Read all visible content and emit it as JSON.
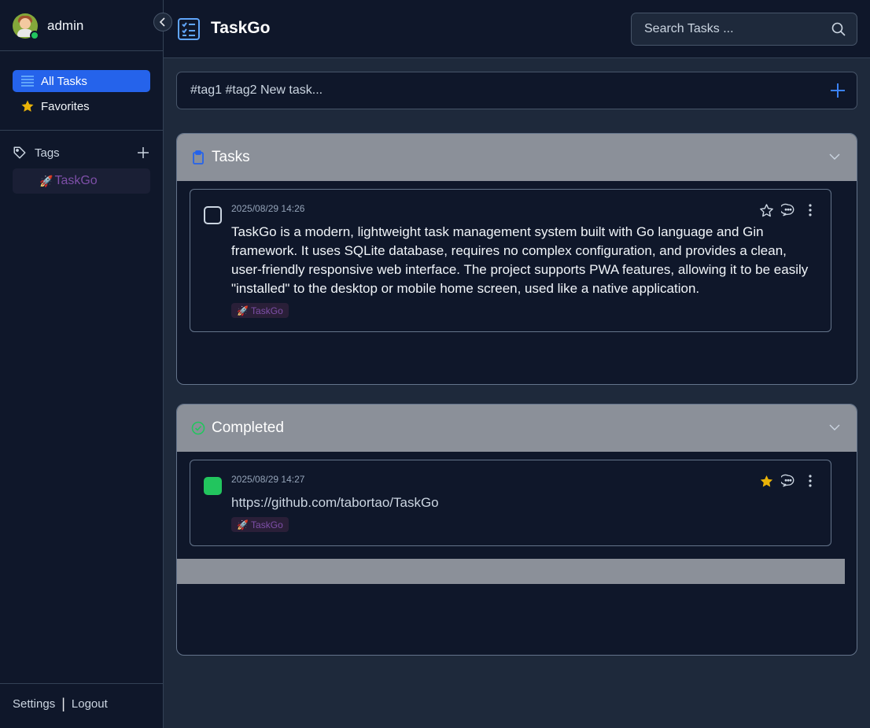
{
  "user": {
    "name": "admin"
  },
  "sidebar": {
    "nav": [
      {
        "label": "All Tasks",
        "icon": "list-icon"
      },
      {
        "label": "Favorites",
        "icon": "star-icon"
      }
    ],
    "tags_header": "Tags",
    "tags": [
      {
        "emoji": "🚀",
        "label": "TaskGo"
      }
    ],
    "footer": {
      "settings": "Settings",
      "separator": "|",
      "logout": "Logout"
    }
  },
  "header": {
    "title": "TaskGo",
    "search_placeholder": "Search Tasks ..."
  },
  "new_task": {
    "placeholder": "#tag1 #tag2 New task..."
  },
  "sections": [
    {
      "title": "Tasks",
      "tasks": [
        {
          "date": "2025/08/29 14:26",
          "text": "TaskGo is a modern, lightweight task management system built with Go language and Gin framework. It uses SQLite database, requires no complex configuration, and provides a clean, user-friendly responsive web interface. The project supports PWA features, allowing it to be easily \"installed\" to the desktop or mobile home screen, used like a native application.",
          "tag": "🚀 TaskGo",
          "completed": false,
          "favorite": false
        }
      ]
    },
    {
      "title": "Completed",
      "tasks": [
        {
          "date": "2025/08/29 14:27",
          "text": "https://github.com/tabortao/TaskGo",
          "tag": "🚀 TaskGo",
          "completed": true,
          "favorite": true
        }
      ]
    }
  ],
  "colors": {
    "accent": "#2563eb",
    "completed": "#22c55e",
    "favorite": "#eab308",
    "tag_text": "#7e4fa8",
    "section_header": "#8b9099"
  }
}
